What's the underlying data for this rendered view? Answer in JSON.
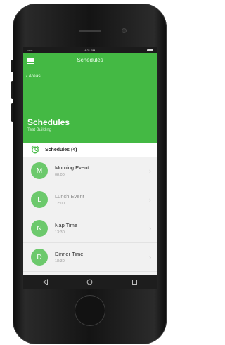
{
  "status_bar": {
    "carrier": "••••••",
    "time": "4:21 PM"
  },
  "appbar": {
    "title": "Schedules",
    "back_label": "‹ Areas",
    "heading": "Schedules",
    "subheading": "Test Building",
    "menu_icon": "hamburger-menu-icon"
  },
  "section": {
    "label": "Schedules (4)",
    "icon": "alarm-clock-icon"
  },
  "schedules": [
    {
      "letter": "M",
      "title": "Morning Event",
      "time": "08:00"
    },
    {
      "letter": "L",
      "title": "Lunch Event",
      "time": "12:00"
    },
    {
      "letter": "N",
      "title": "Nap Time",
      "time": "13:30"
    },
    {
      "letter": "D",
      "title": "Dinner Time",
      "time": "18:30"
    }
  ],
  "nav": {
    "back_icon": "back-triangle-icon",
    "home_icon": "home-circle-icon",
    "recents_icon": "recents-square-icon"
  },
  "colors": {
    "accent": "#44b944",
    "avatar": "#6cc96c",
    "nav_bar": "#1d1d1d"
  }
}
